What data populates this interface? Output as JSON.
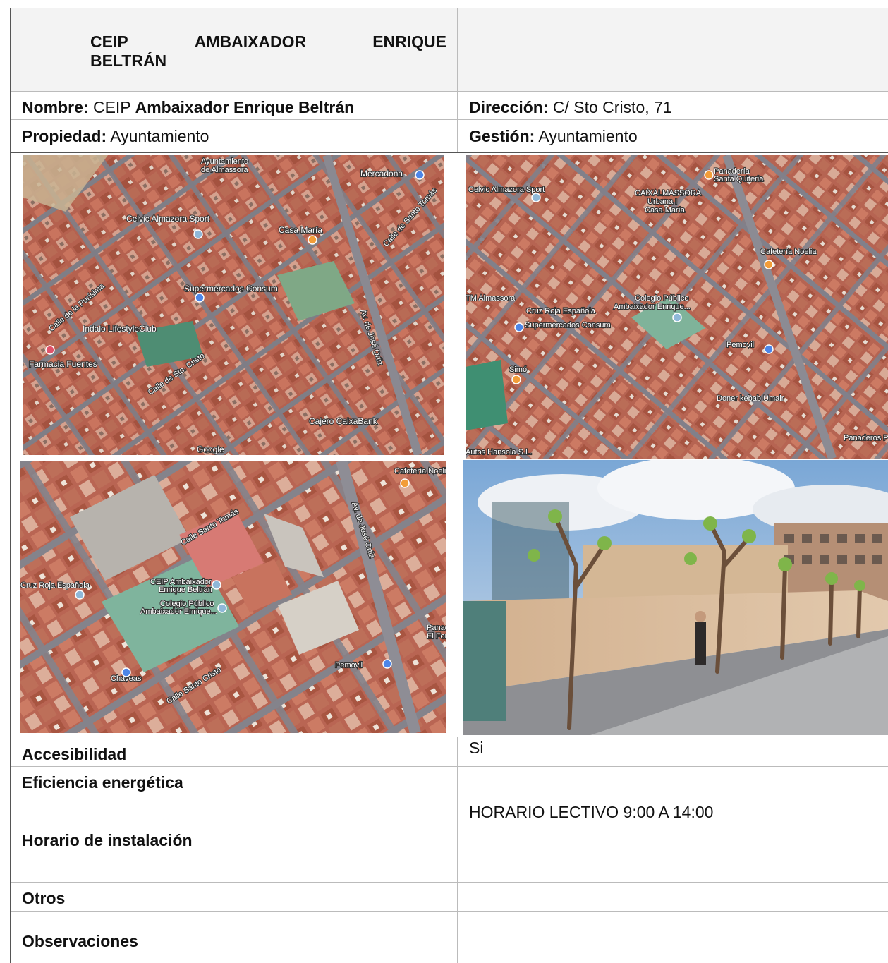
{
  "header": {
    "title_line1_words": [
      "CEIP",
      "AMBAIXADOR",
      "ENRIQUE"
    ],
    "title_line2": "BELTRÁN"
  },
  "info": {
    "nombre_label": "Nombre:",
    "nombre_prefix": "CEIP",
    "nombre_value": "Ambaixador Enrique Beltrán",
    "direccion_label": "Dirección:",
    "direccion_value": "C/ Sto Cristo, 71",
    "propiedad_label": "Propiedad:",
    "propiedad_value": "Ayuntamiento",
    "gestion_label": "Gestión:",
    "gestion_value": "Ayuntamiento"
  },
  "map1": {
    "labels": [
      "Ayuntamiento",
      "de Almassora",
      "Mercadona",
      "Celvic Almazora Sport",
      "Casa María",
      "Supermercados Consum",
      "Indalo LifestyleClub",
      "Farmacia Fuentes",
      "Cajero CaixaBank",
      "Calle de Sto. Cristo",
      "Calle de la Purísima",
      "Av. de José Ortiz",
      "Calle de Santo Tomás",
      "Google"
    ]
  },
  "map2": {
    "labels": [
      "Celvic Almazora Sport",
      "CAIXALMASSORA",
      "Urbana I",
      "Casa María",
      "Panadería",
      "Santa Quiteria",
      "Cafetería Noelia",
      "TM Almassora",
      "Cruz Roja Española",
      "Colegio Público",
      "Ambaixador Enrique...",
      "Supermercados Consum",
      "Pemovil",
      "Doner kebab Umair",
      "Simó",
      "Autos Hansola S.L.",
      "Panaderos Pastelero M"
    ]
  },
  "map3": {
    "labels": [
      "Cafetería Noelia",
      "CEIP Ambaixador",
      "Enrique Beltrán",
      "Colegio Público",
      "Ambaixador Enrique...",
      "Cruz Roja Española",
      "Chaveas",
      "Pemovil",
      "Panad",
      "El Forn",
      "Calle Santo Tomás",
      "Calle Santo Cristo",
      "Av. de José Ortiz"
    ]
  },
  "rows": {
    "accesibilidad_label": "Accesibilidad",
    "accesibilidad_value": "Si",
    "eficiencia_label": "Eficiencia energética",
    "eficiencia_value": "",
    "horario_label": "Horario de instalación",
    "horario_value": "HORARIO LECTIVO 9:00 A 14:00",
    "otros_label": "Otros",
    "otros_value": "",
    "observaciones_label": "Observaciones",
    "observaciones_value": ""
  },
  "colors": {
    "header_bg": "#f3f3f3",
    "border": "#bbbbbb"
  }
}
